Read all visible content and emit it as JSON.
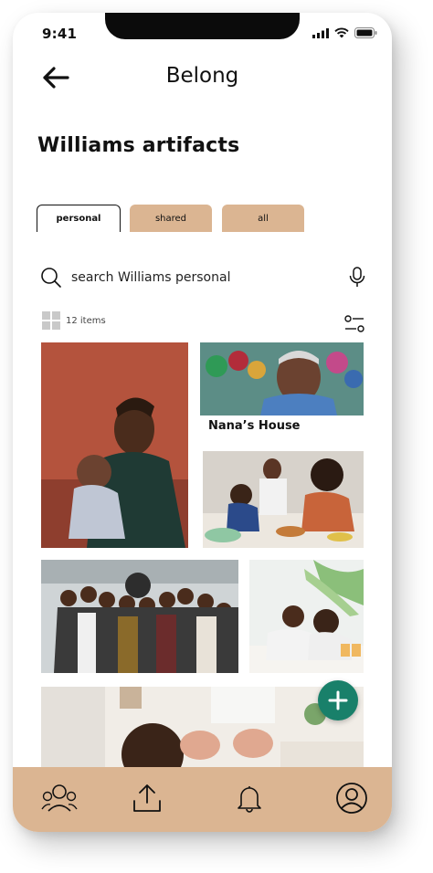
{
  "status_bar": {
    "time": "9:41",
    "icons": [
      "signal-icon",
      "wifi-icon",
      "battery-icon"
    ]
  },
  "header": {
    "title": "Belong",
    "back_icon": "arrow-left-icon"
  },
  "page": {
    "title": "Williams artifacts"
  },
  "tabs": [
    {
      "label": "personal",
      "active": true
    },
    {
      "label": "shared",
      "active": false
    },
    {
      "label": "all",
      "active": false
    }
  ],
  "search": {
    "placeholder": "search Williams personal"
  },
  "collection": {
    "count_label": "12 items"
  },
  "photos": [
    {
      "name": "father-and-baby-photo"
    },
    {
      "name": "grandmother-photo",
      "caption": "Nana’s House"
    },
    {
      "name": "family-cooking-photo"
    },
    {
      "name": "family-group-photo"
    },
    {
      "name": "father-and-son-photo"
    },
    {
      "name": "living-room-photo"
    }
  ],
  "colors": {
    "accent": "#dbb592",
    "fab": "#19806a",
    "text": "#111111"
  },
  "bottom_nav": [
    "community-icon",
    "upload-icon",
    "bell-icon",
    "profile-icon"
  ]
}
